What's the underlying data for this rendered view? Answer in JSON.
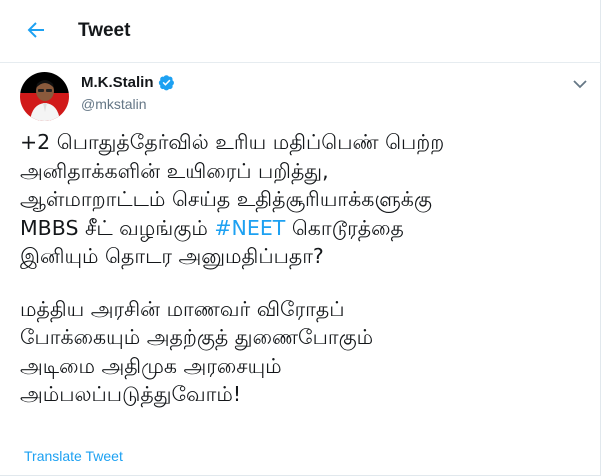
{
  "header": {
    "title": "Tweet",
    "back_icon": "arrow-left-icon"
  },
  "author": {
    "name": "M.K.Stalin",
    "handle": "@mkstalin",
    "verified_icon": "verified-badge-icon",
    "avatar_icon": "avatar"
  },
  "tweet": {
    "line1": "+2 பொதுத்தேர்வில் உரிய மதிப்பெண் பெற்ற",
    "line2": "அனிதாக்களின் உயிரைப் பறித்து,",
    "line3": "ஆள்மாறாட்டம் செய்த உதித்சூரியாக்களுக்கு",
    "line4_pre": "MBBS சீட் வழங்கும் ",
    "hashtag": "#NEET",
    "line4_post": " கொடூரத்தை",
    "line5": "இனியும் தொடர அனுமதிப்பதா?",
    "line6": "மத்திய அரசின் மாணவர் விரோதப்",
    "line7": "போக்கையும் அதற்குத் துணைபோகும்",
    "line8": "அடிமை அதிமுக அரசையும்",
    "line9": "அம்பலப்படுத்துவோம்!"
  },
  "translate_label": "Translate Tweet",
  "colors": {
    "accent": "#1da1f2",
    "text": "#14171a",
    "muted": "#657786"
  }
}
